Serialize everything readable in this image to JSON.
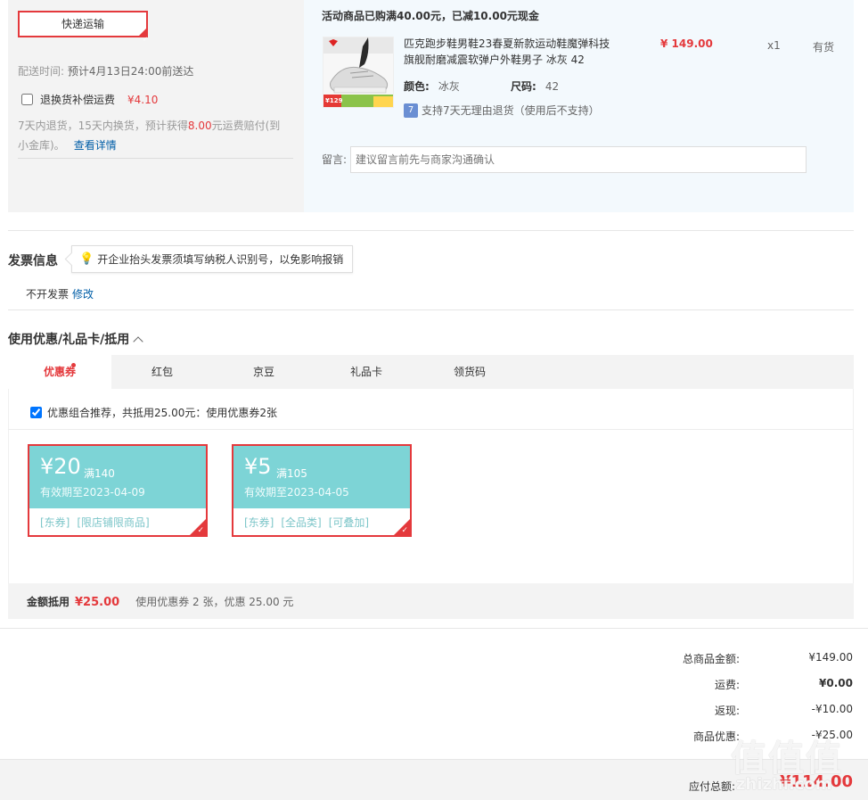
{
  "shipping": {
    "method_label": "快递运输",
    "delivery_label": "配送时间:",
    "delivery_value": "预计4月13日24:00前送达",
    "return_insurance_label": "退换货补偿运费",
    "return_insurance_price": "¥4.10",
    "return_desc_1": "7天内退货，15天内换货，预计获得",
    "return_desc_amount": "8.00",
    "return_desc_2": "元运费赔付(到小金库)。",
    "return_desc_link": "查看详情"
  },
  "order": {
    "promo_notice": "活动商品已购满40.00元，已减10.00元现金",
    "product_name": "匹克跑步鞋男鞋23春夏新款运动鞋魔弹科技旗舰耐磨减震软弹户外鞋男子 冰灰 42",
    "price": "¥ 149.00",
    "quantity": "x1",
    "stock": "有货",
    "color_label": "颜色:",
    "color_value": "冰灰",
    "size_label": "尺码:",
    "size_value": "42",
    "return_badge": "7",
    "return_policy": "支持7天无理由退货（使用后不支持）",
    "memo_label": "留言:",
    "memo_placeholder": "建议留言前先与商家沟通确认",
    "thumb_price": "¥129"
  },
  "invoice": {
    "title": "发票信息",
    "tip": "开企业抬头发票须填写纳税人识别号，以免影响报销",
    "status": "不开发票",
    "edit_link": "修改"
  },
  "discount": {
    "title": "使用优惠/礼品卡/抵用",
    "tabs": [
      {
        "label": "优惠券"
      },
      {
        "label": "红包"
      },
      {
        "label": "京豆"
      },
      {
        "label": "礼品卡"
      },
      {
        "label": "领货码"
      }
    ],
    "recommend": "优惠组合推荐，共抵用25.00元：使用优惠券2张",
    "coupons": [
      {
        "amount": "¥20",
        "condition": "满140",
        "expiry": "有效期至2023-04-09",
        "tags": [
          "[东券]",
          "[限店铺限商品]"
        ]
      },
      {
        "amount": "¥5",
        "condition": "满105",
        "expiry": "有效期至2023-04-05",
        "tags": [
          "[东券]",
          "[全品类]",
          "[可叠加]"
        ]
      }
    ],
    "summary_label": "金额抵用",
    "summary_amount": "¥25.00",
    "summary_note": "使用优惠券 2 张，优惠 25.00 元"
  },
  "totals": {
    "rows": [
      {
        "label": "总商品金额:",
        "value": "¥149.00"
      },
      {
        "label": "运费:",
        "value": "¥0.00"
      },
      {
        "label": "返现:",
        "value": "-¥10.00"
      },
      {
        "label": "商品优惠:",
        "value": "-¥25.00"
      }
    ],
    "payable_label": "应付总额:",
    "payable_value": "¥114.00"
  },
  "watermark": {
    "main": "值值值",
    "sub": "zhizhi.com"
  },
  "colors": {
    "accent": "#e4393c",
    "coupon": "#7dd4d6",
    "link": "#005ea7"
  }
}
